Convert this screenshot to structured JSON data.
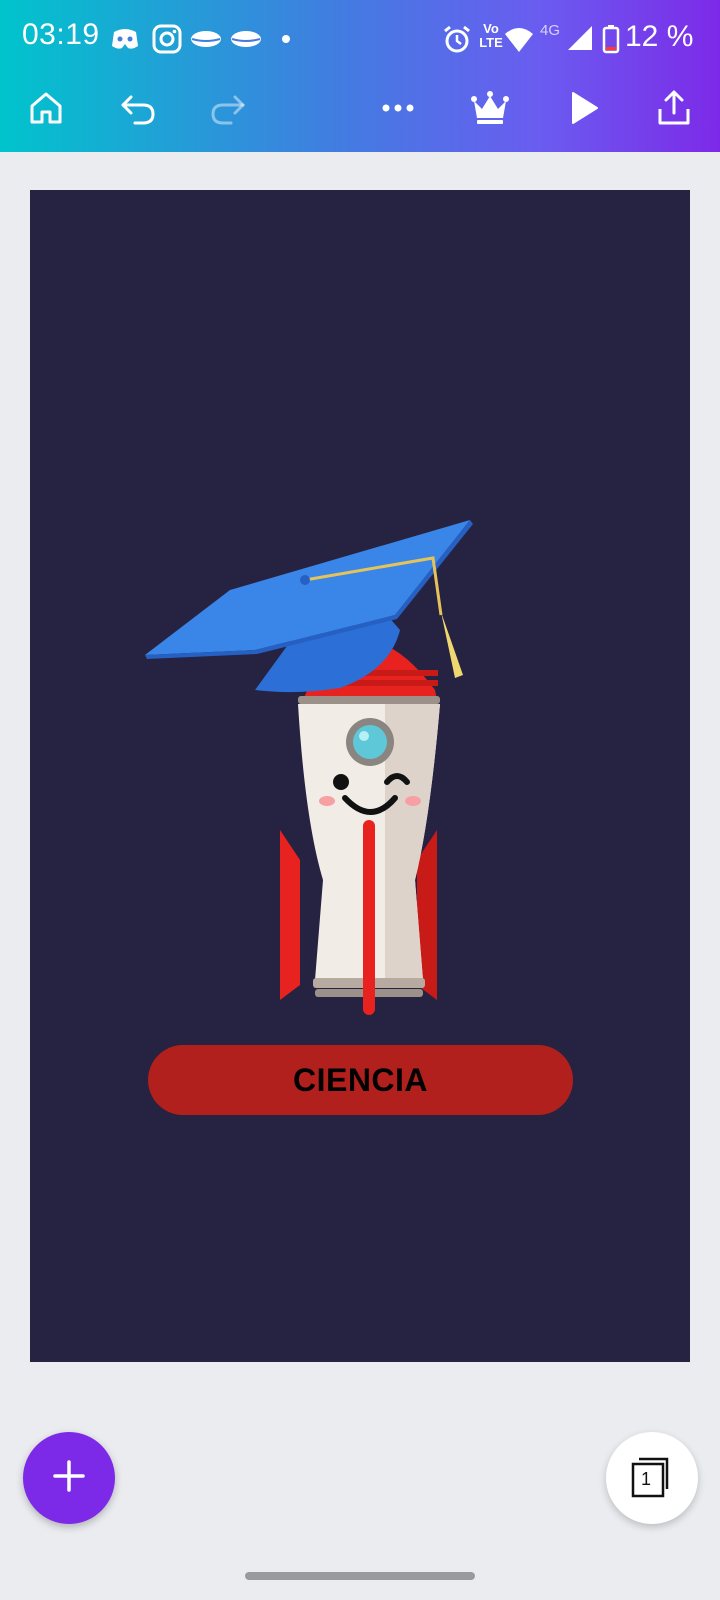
{
  "status_bar": {
    "time": "03:19",
    "network": "4G",
    "volte": "Vo LTE",
    "battery": "12 %",
    "icons": [
      "discord-icon",
      "instagram-icon",
      "lips-icon",
      "lips-icon",
      "dot-icon",
      "alarm-icon",
      "volte-icon",
      "wifi-icon",
      "signal-icon",
      "battery-icon"
    ]
  },
  "toolbar": {
    "icons": [
      "home-icon",
      "undo-icon",
      "redo-icon",
      "more-icon",
      "crown-icon",
      "play-icon",
      "share-icon"
    ],
    "gradient": [
      "#00c4cc",
      "#7d2ae8"
    ]
  },
  "canvas": {
    "background": "#262241",
    "label": "CIENCIA",
    "label_bg": "#b1201c"
  },
  "fab": {
    "icon": "plus-icon",
    "color": "#7d2ae8"
  },
  "pages": {
    "count": "1"
  }
}
